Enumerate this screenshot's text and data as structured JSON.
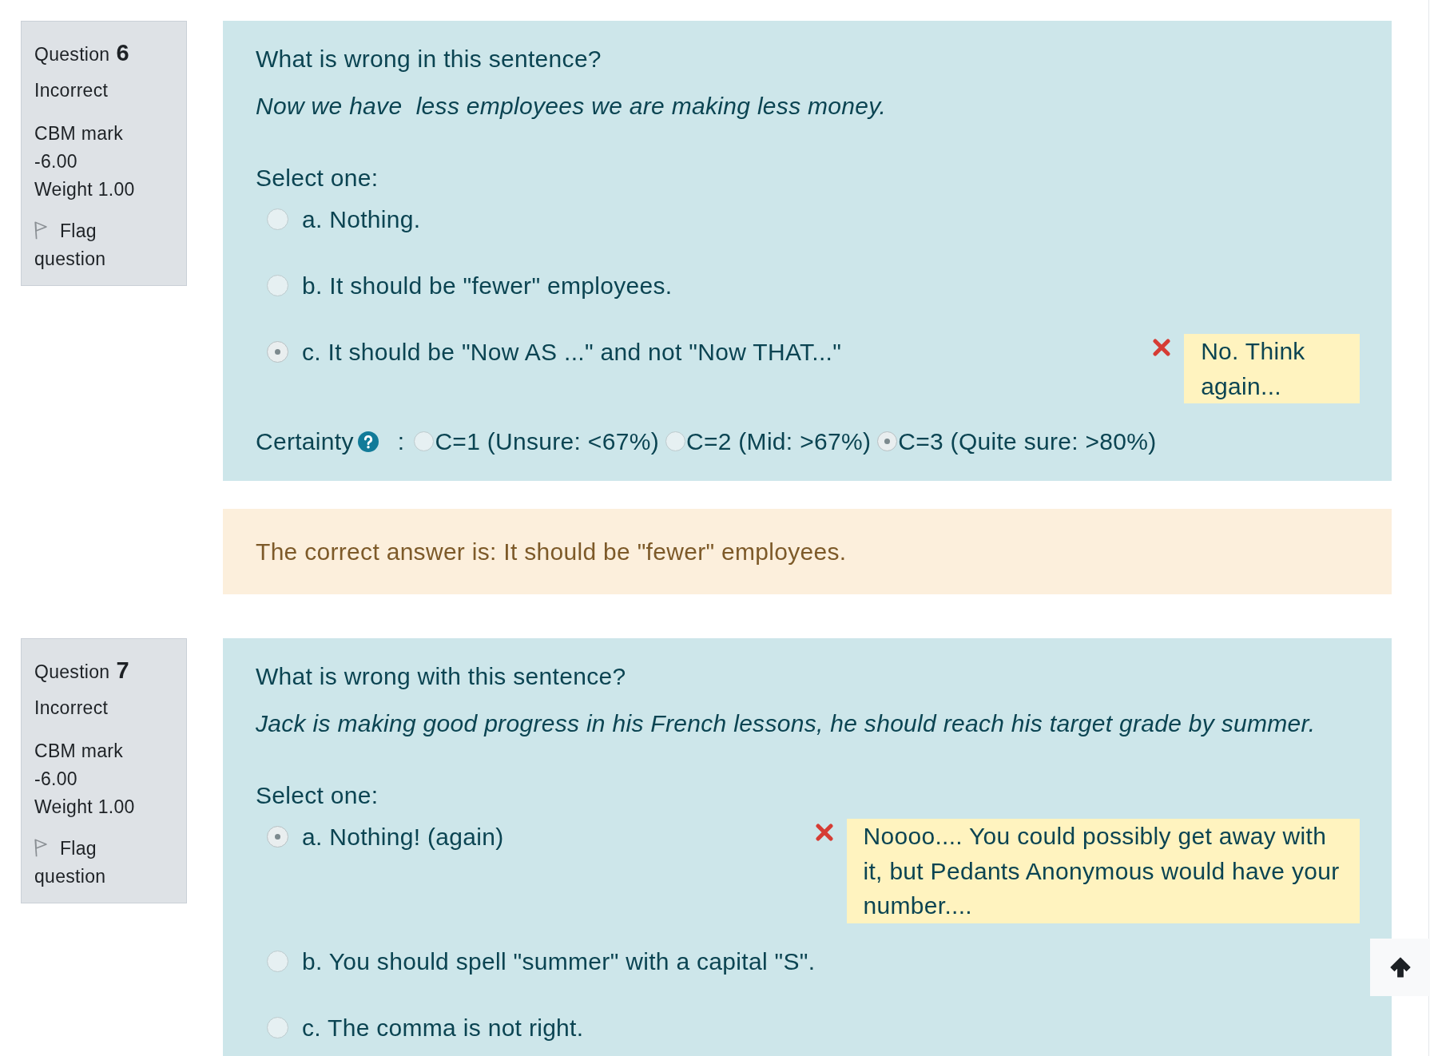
{
  "questions": [
    {
      "info": {
        "label": "Question",
        "number": "6",
        "state": "Incorrect",
        "mark_label": "CBM mark",
        "mark": "-6.00",
        "weight": "Weight 1.00",
        "flag": {
          "label": "Flag question",
          "flagged": false
        }
      },
      "prompt": "What is wrong in this sentence?",
      "sentence": "Now we have  less employees we are making less money.",
      "select_label": "Select one:",
      "options": [
        {
          "label": "a. Nothing.",
          "selected": false,
          "incorrect": false
        },
        {
          "label": "b. It should be \"fewer\" employees.",
          "selected": false,
          "incorrect": false
        },
        {
          "label": "c. It should be \"Now AS ...\" and not \"Now THAT...\"",
          "selected": true,
          "incorrect": true,
          "feedback": "No. Think again..."
        }
      ],
      "certainty": {
        "label": "Certainty",
        "separator": ":",
        "options": [
          {
            "label": "C=1 (Unsure: <67%)",
            "selected": false
          },
          {
            "label": "C=2 (Mid: >67%)",
            "selected": false
          },
          {
            "label": "C=3 (Quite sure: >80%)",
            "selected": true
          }
        ]
      },
      "correct_answer": "The correct answer is: It should be \"fewer\" employees."
    },
    {
      "info": {
        "label": "Question",
        "number": "7",
        "state": "Incorrect",
        "mark_label": "CBM mark",
        "mark": "-6.00",
        "weight": "Weight 1.00",
        "flag": {
          "label": "Flag question",
          "flagged": false
        }
      },
      "prompt": "What is wrong with this sentence?",
      "sentence": "Jack is making good progress in his French lessons, he should reach his target grade by summer.",
      "select_label": "Select one:",
      "options": [
        {
          "label": "a. Nothing! (again)",
          "selected": true,
          "incorrect": true,
          "feedback": "Noooo.... You could possibly get away with it, but Pedants Anonymous would have your number...."
        },
        {
          "label": "b. You should spell \"summer\" with a capital \"S\".",
          "selected": false,
          "incorrect": false
        },
        {
          "label": "c. The comma is not right.",
          "selected": false,
          "incorrect": false
        }
      ]
    }
  ]
}
